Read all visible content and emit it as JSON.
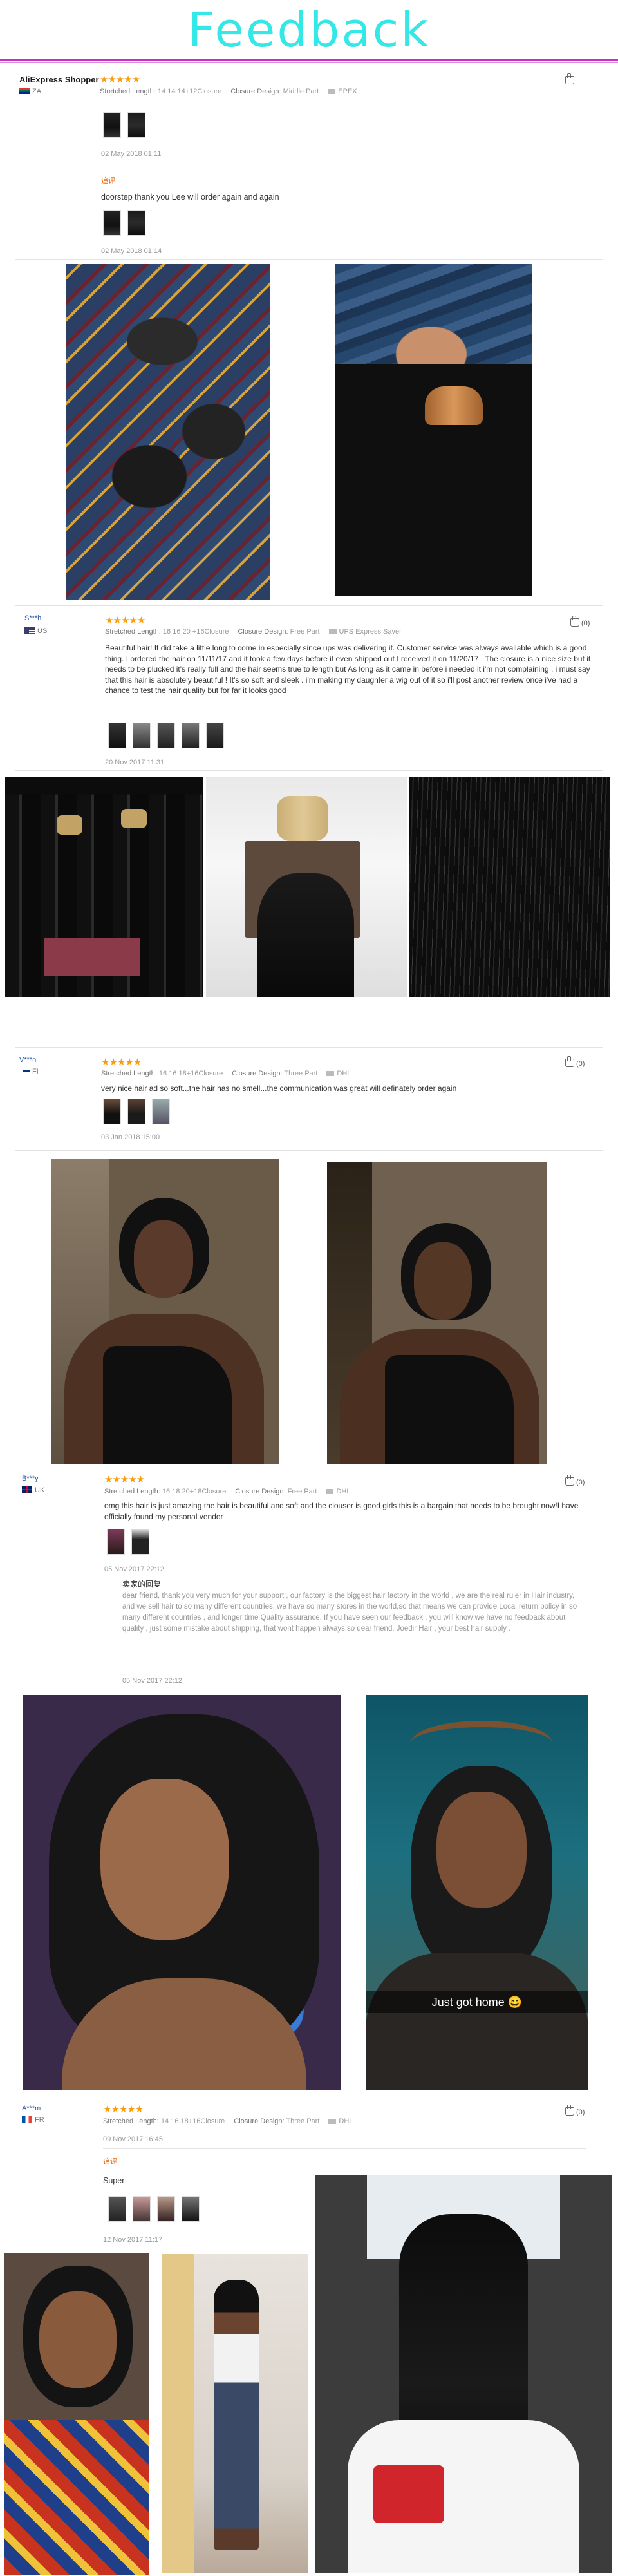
{
  "banner": {
    "title": "Feedback"
  },
  "reviews": [
    {
      "name": "AliExpress Shopper",
      "country": "ZA",
      "stars": "★★★★★",
      "length_label": "Stretched Length:",
      "length_value": "14 14 14+12Closure",
      "closure_label": "Closure Design:",
      "closure_value": "Middle Part",
      "shipping": "EPEX",
      "date1": "02 May 2018 01:11",
      "followup_tag": "追评",
      "followup_text": "doorstep thank you Lee will order again and again",
      "date2": "02 May 2018 01:14"
    },
    {
      "name": "S***h",
      "country": "US",
      "stars": "★★★★★",
      "length_label": "Stretched Length:",
      "length_value": "16 16 20 +16Closure",
      "closure_label": "Closure Design:",
      "closure_value": "Free Part",
      "shipping": "UPS Express Saver",
      "helpful": "(0)",
      "text": "Beautiful hair! It did take a little long to come in especially since ups was delivering it. Customer service was always available which is a good thing. I ordered the hair on 11/11/17 and it took a few days before it even shipped out I received it on 11/20/17 . The closure is a nice size but it needs to be plucked it's really full and the hair seems true to length but As long as it came in before i needed it i'm not complaining . i must say that this hair is absolutely beautiful ! It's so soft and sleek . i'm making my daughter a wig out of it so i'll post another review once i've had a chance to test the hair quality but for far it looks good",
      "date": "20 Nov 2017 11:31"
    },
    {
      "name": "V***n",
      "country": "FI",
      "stars": "★★★★★",
      "length_label": "Stretched Length:",
      "length_value": "16 16 18+16Closure",
      "closure_label": "Closure Design:",
      "closure_value": "Three Part",
      "shipping": "DHL",
      "helpful": "(0)",
      "text": "very nice hair ad so soft...the hair has no smell...the communication was great will definately order again",
      "date": "03 Jan 2018 15:00"
    },
    {
      "name": "B***y",
      "country": "UK",
      "stars": "★★★★★",
      "length_label": "Stretched Length:",
      "length_value": "16 18 20+18Closure",
      "closure_label": "Closure Design:",
      "closure_value": "Free Part",
      "shipping": "DHL",
      "helpful": "(0)",
      "text": "omg this hair is just amazing the hair is beautiful and soft and the clouser is good girls this is a bargain that needs to be brought now!I have officially found my personal vendor",
      "date": "05 Nov 2017 22:12",
      "seller_tag": "卖家的回复",
      "reply": "dear friend, thank you very much for your support , our factory is the biggest hair factory in the world , we are the real ruler in Hair industry, and we sell hair to so many different countries, we have so many stores in the world,so that means we can provide Local return policy in so many different countries , and longer time Quality assurance. If you have seen our feedback , you will know we have no feedback about quality , just some mistake about shipping, that wont happen always,so dear friend, Joedir Hair , your best hair supply .",
      "reply_date": "05 Nov 2017 22:12",
      "caption": "Just got home 😄"
    },
    {
      "name": "A***m",
      "country": "FR",
      "stars": "★★★★★",
      "length_label": "Stretched Length:",
      "length_value": "14 16 18+16Closure",
      "closure_label": "Closure Design:",
      "closure_value": "Three Part",
      "shipping": "DHL",
      "helpful": "(0)",
      "date": "09 Nov 2017 16:45",
      "followup_tag": "追评",
      "followup_text": "Super",
      "date2": "12 Nov 2017 11:17"
    }
  ],
  "icons": {
    "thumbs_up": "thumbs-up-icon",
    "shipping": "truck-icon"
  },
  "colors": {
    "title": "#35e8e8",
    "stars": "#ff9a00",
    "accent_line": "#c630c6"
  }
}
